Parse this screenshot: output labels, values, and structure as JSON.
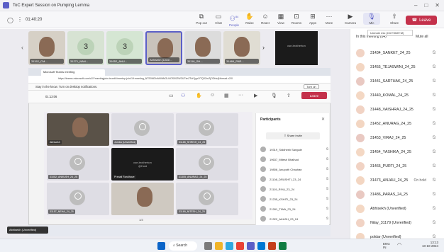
{
  "window": {
    "title": "ToC Expert Session on Pumping Lemma",
    "timer": "01:40:20"
  },
  "toolbar": {
    "buttons": [
      {
        "icon": "pop-out-icon",
        "label": "Pop out"
      },
      {
        "icon": "chat-icon",
        "label": "Chat"
      },
      {
        "icon": "people-icon",
        "label": "People",
        "badge": "84"
      },
      {
        "icon": "raise-hand-icon",
        "label": "Raise"
      },
      {
        "icon": "react-icon",
        "label": "React"
      },
      {
        "icon": "view-icon",
        "label": "View"
      },
      {
        "icon": "rooms-icon",
        "label": "Rooms"
      },
      {
        "icon": "apps-icon",
        "label": "Apps"
      },
      {
        "icon": "more-icon",
        "label": "More"
      },
      {
        "icon": "camera-icon",
        "label": "Camera"
      },
      {
        "icon": "mic-icon",
        "label": "Mic"
      },
      {
        "icon": "share-icon",
        "label": "Share"
      }
    ],
    "leave_label": "Leave",
    "mic_tooltip": "Unmute mic (Ctrl+Shift+M)"
  },
  "video_strip": [
    {
      "name": "31152_CM...",
      "kind": "face"
    },
    {
      "name": "31271_NAN...",
      "kind": "number",
      "number": "3"
    },
    {
      "name": "31052_ANU...",
      "kind": "number",
      "number": "3"
    },
    {
      "name": "Abhisekh (Unve...",
      "kind": "face"
    },
    {
      "name": "31116_SH...",
      "kind": "face"
    },
    {
      "name": "31466_PAR...",
      "kind": "face"
    },
    {
      "name": "",
      "kind": "dark"
    }
  ],
  "strip_dark_text": "cse-brotherton",
  "side_panel": {
    "header": "In this meeting (84)",
    "mute_all": "Mute all",
    "participants": [
      {
        "name": "31434_SANKET_24_25",
        "status": ""
      },
      {
        "name": "31455_TEJASWINI_24_25",
        "status": ""
      },
      {
        "name": "31441_SARTHAK_24_25",
        "status": ""
      },
      {
        "name": "31440_KOMAL_24_25",
        "status": ""
      },
      {
        "name": "31448_VAISHRAJ_24_25",
        "status": ""
      },
      {
        "name": "31452_ANURAG_24_25",
        "status": ""
      },
      {
        "name": "31453_VIRAJ_24_25",
        "status": ""
      },
      {
        "name": "31454_YASHIKA_24_25",
        "status": ""
      },
      {
        "name": "31465_PURTI_24_25",
        "status": ""
      },
      {
        "name": "31473_ANJALI_24_25",
        "status": "On hold"
      },
      {
        "name": "31486_PARAS_24_25",
        "status": ""
      },
      {
        "name": "Abhisekh (Unverified)",
        "status": ""
      },
      {
        "name": "Nilay_31179 (Unverified)",
        "status": ""
      },
      {
        "name": "poldar (Unverified)",
        "status": ""
      }
    ]
  },
  "inner_window": {
    "tab_title": "Microsoft Teams meeting",
    "url": "https://teams.microsoft.com/v2/?meetingjoin=true#/l/meetup-join/19:meeting_NTE0NDIxNWItNGU4OS00ZWZiLTlmZTctYjgxOTQ0ZmZjODhk@thread.v2/0",
    "notification": "Stay in the know. Turn on desktop notifications.",
    "notification_btn": "Turn on",
    "timer": "01:13:06",
    "leave": "Leave",
    "participants_title": "Participants",
    "share_invite": "Share invite",
    "grid": [
      {
        "name": "Abhisekh",
        "kind": "face"
      },
      {
        "name": "Jumba (Unverified)",
        "kind": "avatar"
      },
      {
        "name": "31185_SHRISH_24_25",
        "kind": "avatar"
      },
      {
        "name": "31052_ANKUSH_24_25",
        "kind": "avatar"
      },
      {
        "name": "Pranali Randhave",
        "kind": "dark"
      },
      {
        "name": "31305_ANURAG_24_25",
        "kind": "avatar"
      },
      {
        "name": "31157_NEHA_24_25",
        "kind": "avatar"
      },
      {
        "name": "",
        "kind": "face"
      },
      {
        "name": "31169_NITESH_24_25",
        "kind": "avatar"
      }
    ],
    "grid_dark_text": "cse-brotherton",
    "grid_dark_sub": "@Hold",
    "page": "1/3",
    "list": [
      "19319_Siddhesh Sangale",
      "19637_Mitesh Bhalhad",
      "19806_Anupoth Chauhan",
      "21108_DRUSHTI_23_24",
      "21119_RIYA_23_24",
      "21235_KSHITI_23_24",
      "21281_TIWA_23_24",
      "21322_AKASH_23_24"
    ],
    "inner_user": "Abhisekh (Unverified)"
  },
  "taskbar": {
    "search": "Search",
    "lang": "ENG IN",
    "time": "13:13",
    "date": "10-10-2024"
  },
  "colors": {
    "accent": "#5b5fc7",
    "leave": "#c4314b"
  }
}
